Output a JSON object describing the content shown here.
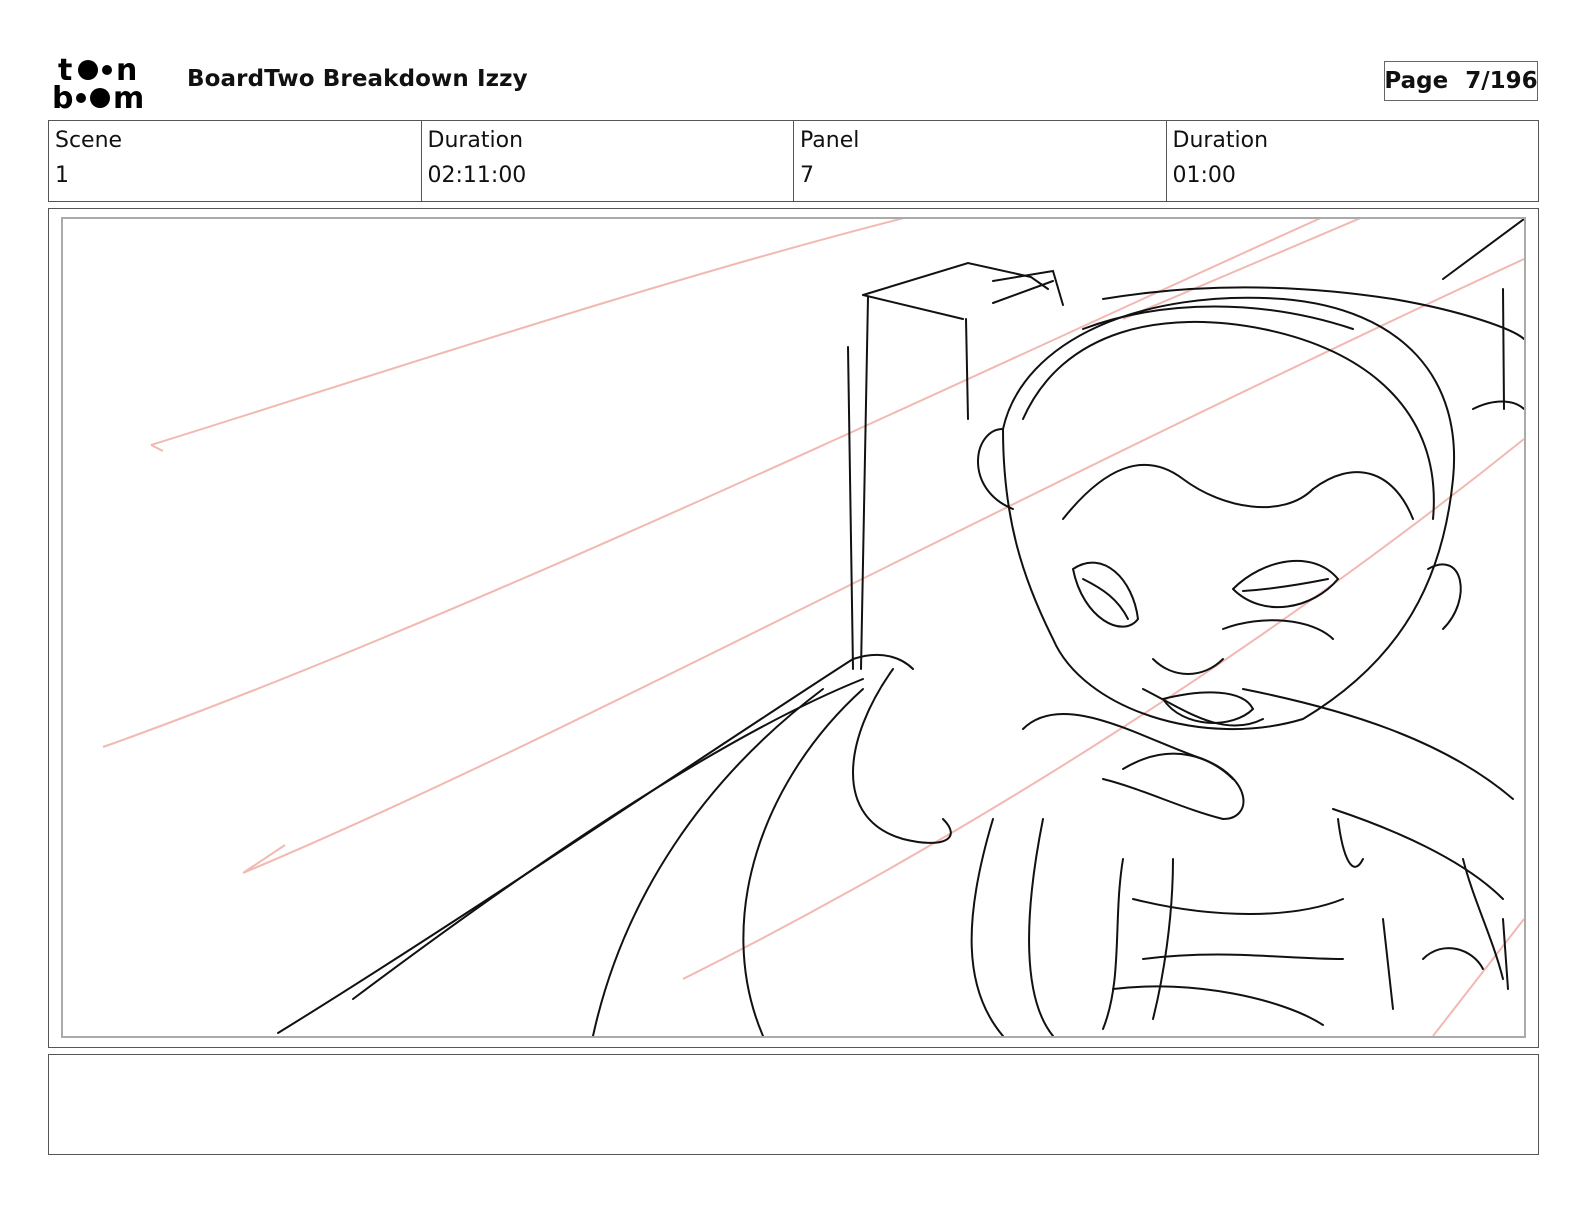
{
  "header": {
    "logo_text": "toon boom",
    "title": "BoardTwo Breakdown Izzy",
    "page_label": "Page",
    "page_value": "7/196"
  },
  "info": {
    "scene_label": "Scene",
    "scene_value": "1",
    "scene_duration_label": "Duration",
    "scene_duration_value": "02:11:00",
    "panel_label": "Panel",
    "panel_value": "7",
    "panel_duration_label": "Duration",
    "panel_duration_value": "01:00"
  },
  "notes": {
    "text": ""
  },
  "colors": {
    "sketch_line": "#111111",
    "guide_line": "#f1b9b1",
    "border": "#555555"
  }
}
